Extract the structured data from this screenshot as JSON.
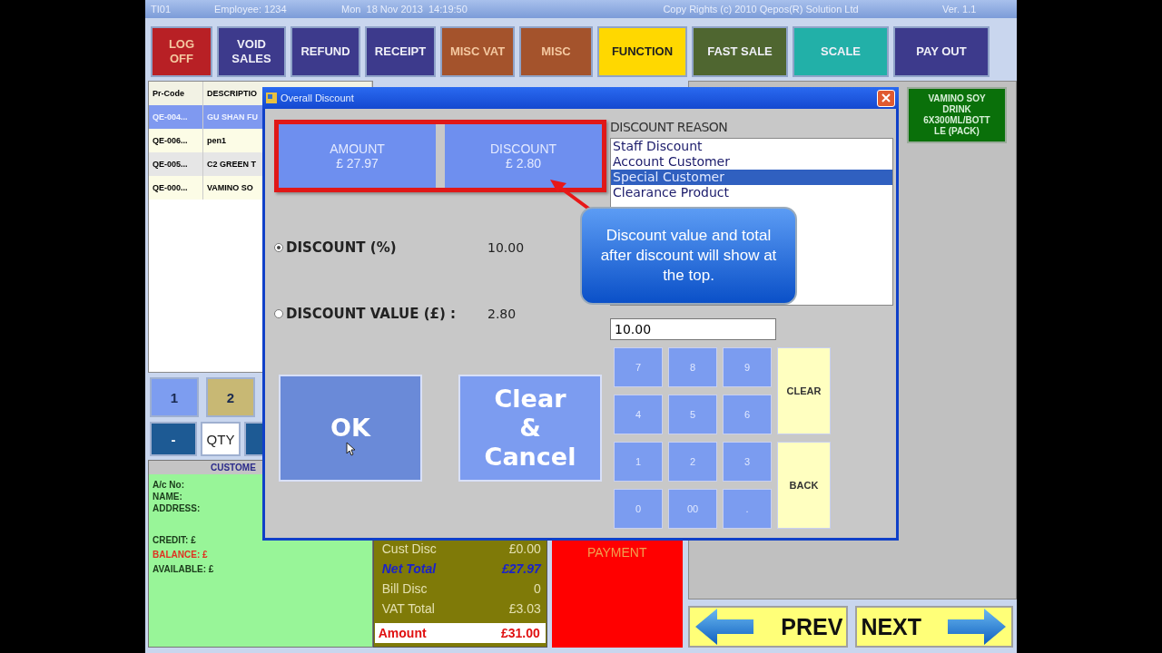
{
  "title_bar": {
    "till": "TI01",
    "employee": "Employee: 1234",
    "datetime": "Mon  18 Nov 2013  14:19:50",
    "copyright": "Copy Rights (c) 2010 Qepos(R) Solution Ltd",
    "version": "Ver. 1.1"
  },
  "toolbar": [
    {
      "label": "LOG\nOFF",
      "color": "#b82025"
    },
    {
      "label": "VOID\nSALES",
      "color": "#3d3a8c"
    },
    {
      "label": "REFUND",
      "color": "#3d3a8c"
    },
    {
      "label": "RECEIPT",
      "color": "#3d3a8c"
    },
    {
      "label": "MISC VAT",
      "color": "#a4532c"
    },
    {
      "label": "MISC",
      "color": "#a4532c"
    },
    {
      "label": "FUNCTION",
      "color": "#ffd800"
    },
    {
      "label": "FAST SALE",
      "color": "#4f6630"
    },
    {
      "label": "SCALE",
      "color": "#22b0a8"
    },
    {
      "label": "PAY OUT",
      "color": "#3d3a8c"
    }
  ],
  "order_table": {
    "columns": [
      "Pr-Code",
      "DESCRIPTIO"
    ],
    "rows": [
      {
        "code": "QE-004...",
        "description": "GU SHAN FU",
        "selected": true
      },
      {
        "code": "QE-006...",
        "description": "pen1",
        "selected": false
      },
      {
        "code": "QE-005...",
        "description": "C2 GREEN T",
        "selected": false
      },
      {
        "code": "QE-000...",
        "description": "VAMINO SO",
        "selected": false
      }
    ]
  },
  "quick_keys": [
    [
      {
        "label": "1",
        "color": "#7d9df0"
      },
      {
        "label": "2",
        "color": "#c8b874"
      }
    ],
    [
      {
        "label": "-",
        "color": "#1d5a94"
      },
      {
        "label": "QTY",
        "color": "#ffffff"
      },
      {
        "color": "#1d5a94"
      }
    ]
  ],
  "customer": {
    "header": "CUSTOME",
    "groups": [
      [
        {
          "text": "A/c No:",
          "kind": "normal"
        },
        {
          "text": "NAME:",
          "kind": "normal"
        },
        {
          "text": "ADDRESS:",
          "kind": "normal"
        }
      ],
      [
        {
          "text": "CREDIT: £",
          "kind": "normal"
        },
        {
          "text": "BALANCE: £",
          "kind": "alert"
        },
        {
          "text": "AVAILABLE: £",
          "kind": "normal"
        }
      ]
    ]
  },
  "totals": [
    {
      "label": "Cust Disc",
      "value": "£0.00",
      "kind": "plain"
    },
    {
      "label": "Net Total",
      "value": "£27.97",
      "kind": "net"
    },
    {
      "label": "Bill Disc",
      "value": "0",
      "kind": "plain"
    },
    {
      "label": "VAT Total",
      "value": "£3.03",
      "kind": "plain"
    },
    {
      "label": "Amount",
      "value": "£31.00",
      "kind": "amount"
    }
  ],
  "payment": {
    "label": "PAYMENT"
  },
  "product_tiles": [
    {
      "label": "VAMINO SOY DRINK 6X300ML/BOTTLE (PACK)"
    }
  ],
  "nav": [
    {
      "label": "PREV",
      "kind": "prev"
    },
    {
      "label": "NEXT",
      "kind": "next"
    }
  ],
  "dialog": {
    "title": "Overall Discount",
    "summary": [
      {
        "label": "AMOUNT",
        "value": "£ 27.97"
      },
      {
        "label": "DISCOUNT",
        "value": "£ 2.80"
      }
    ],
    "options": [
      {
        "label": "DISCOUNT (%)",
        "value": "10.00",
        "selected": true
      },
      {
        "label": "DISCOUNT VALUE (£) :",
        "value": "2.80",
        "selected": false
      }
    ],
    "actions": [
      {
        "label": "OK",
        "kind": "ok"
      },
      {
        "label": "Clear\n&\nCancel",
        "kind": "cancel"
      }
    ],
    "reason_label": "DISCOUNT REASON",
    "reasons": [
      {
        "label": "Staff Discount",
        "selected": false
      },
      {
        "label": "Account Customer",
        "selected": false
      },
      {
        "label": "Special Customer",
        "selected": true
      },
      {
        "label": "Clearance Product",
        "selected": false
      }
    ],
    "entry": {
      "value": "10.00"
    },
    "keypad": [
      {
        "label": "7",
        "kind": "digit"
      },
      {
        "label": "8",
        "kind": "digit"
      },
      {
        "label": "9",
        "kind": "digit"
      },
      {
        "label": "CLEAR",
        "kind": "function"
      },
      {
        "label": "4",
        "kind": "digit"
      },
      {
        "label": "5",
        "kind": "digit"
      },
      {
        "label": "6",
        "kind": "digit"
      },
      {
        "label": "1",
        "kind": "digit"
      },
      {
        "label": "2",
        "kind": "digit"
      },
      {
        "label": "3",
        "kind": "digit"
      },
      {
        "label": "BACK",
        "kind": "function"
      },
      {
        "label": "0",
        "kind": "digit"
      },
      {
        "label": "00",
        "kind": "digit"
      },
      {
        "label": ".",
        "kind": "digit"
      }
    ],
    "callout": {
      "text": "Discount value and total after discount will show at the top."
    }
  }
}
